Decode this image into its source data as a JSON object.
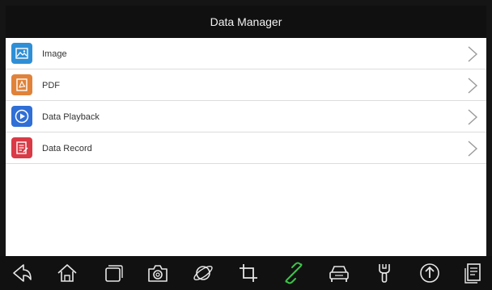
{
  "header": {
    "title": "Data Manager"
  },
  "list": {
    "items": [
      {
        "label": "Image",
        "icon": "image-icon",
        "color": "#2f8fd6"
      },
      {
        "label": "PDF",
        "icon": "pdf-icon",
        "color": "#e0823a"
      },
      {
        "label": "Data Playback",
        "icon": "playback-icon",
        "color": "#2f6fd6"
      },
      {
        "label": "Data Record",
        "icon": "record-icon",
        "color": "#d93a45"
      }
    ]
  },
  "navbar": {
    "buttons": [
      {
        "name": "back-icon"
      },
      {
        "name": "home-icon"
      },
      {
        "name": "recent-apps-icon"
      },
      {
        "name": "camera-icon"
      },
      {
        "name": "browser-icon"
      },
      {
        "name": "crop-icon"
      },
      {
        "name": "link-icon",
        "color": "#3ec24a"
      },
      {
        "name": "car-icon"
      },
      {
        "name": "wrench-icon"
      },
      {
        "name": "upload-icon"
      },
      {
        "name": "document-icon"
      }
    ]
  }
}
